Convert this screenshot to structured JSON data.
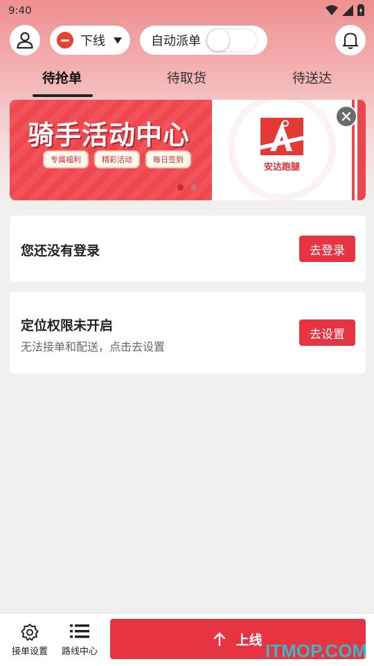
{
  "status_bar": {
    "time": "9:40"
  },
  "header": {
    "status_label": "下线",
    "auto_dispatch_label": "自动派单",
    "auto_dispatch_on": false
  },
  "tabs": [
    {
      "label": "待抢单",
      "active": true
    },
    {
      "label": "待取货",
      "active": false
    },
    {
      "label": "待送达",
      "active": false
    }
  ],
  "banner": {
    "title": "骑手活动中心",
    "tags": [
      "专属福利",
      "精彩活动",
      "每日签到"
    ],
    "brand_name": "安达跑腿",
    "page_index": 1,
    "page_count": 2
  },
  "login_card": {
    "title": "您还没有登录",
    "button": "去登录"
  },
  "location_card": {
    "title": "定位权限未开启",
    "subtitle": "无法接单和配送，点击去设置",
    "button": "去设置"
  },
  "bottom_nav": {
    "settings_label": "接单设置",
    "routes_label": "路线中心",
    "go_online_label": "上线"
  },
  "watermark": "ITMOP.COM",
  "colors": {
    "accent": "#e63443",
    "status_red": "#e8412e"
  }
}
